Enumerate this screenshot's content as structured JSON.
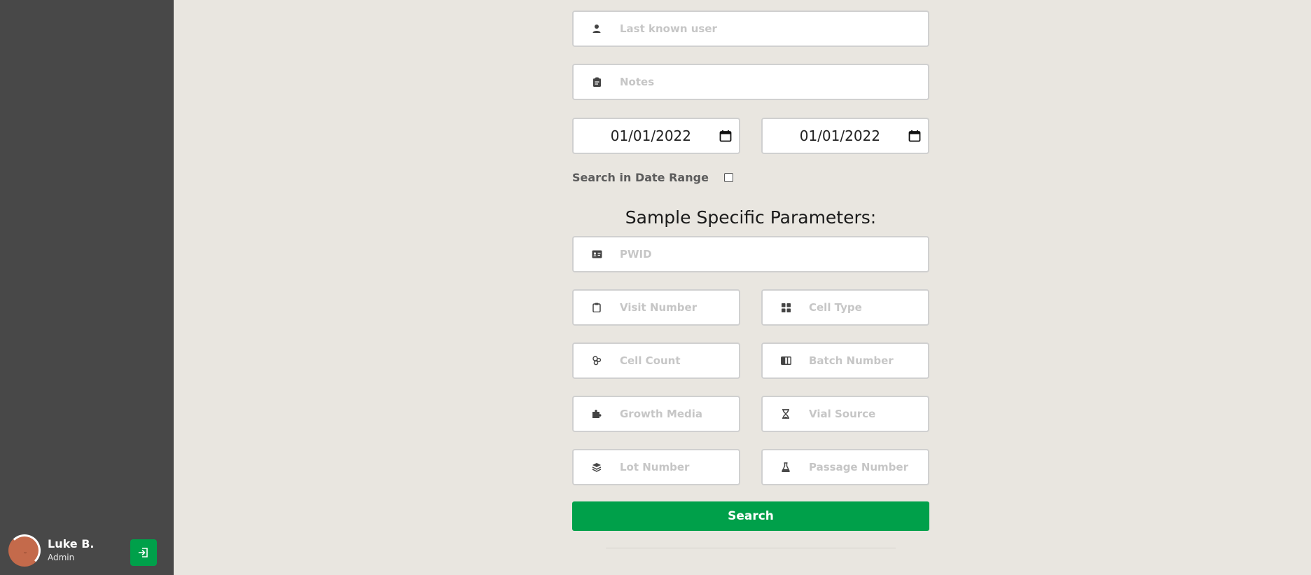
{
  "sidebar": {
    "user": {
      "name": "Luke B.",
      "role": "Admin"
    }
  },
  "form": {
    "last_known_user": {
      "placeholder": "Last known user",
      "icon": "user-icon"
    },
    "notes": {
      "placeholder": "Notes",
      "icon": "clipboard-icon"
    },
    "date_from": {
      "value": "01/01/2022"
    },
    "date_to": {
      "value": "01/01/2022"
    },
    "date_range": {
      "label": "Search in Date Range",
      "checked": false
    },
    "section_title": "Sample Specific Parameters:",
    "pwid": {
      "placeholder": "PWID",
      "icon": "id-card-icon"
    },
    "visit_number": {
      "placeholder": "Visit Number",
      "icon": "clipboard-outline-icon"
    },
    "cell_type": {
      "placeholder": "Cell Type",
      "icon": "grid-icon"
    },
    "cell_count": {
      "placeholder": "Cell Count",
      "icon": "cells-icon"
    },
    "batch_number": {
      "placeholder": "Batch Number",
      "icon": "columns-icon"
    },
    "growth_media": {
      "placeholder": "Growth Media",
      "icon": "puzzle-icon"
    },
    "vial_source": {
      "placeholder": "Vial Source",
      "icon": "hourglass-icon"
    },
    "lot_number": {
      "placeholder": "Lot Number",
      "icon": "layers-icon"
    },
    "passage_number": {
      "placeholder": "Passage Number",
      "icon": "flask-icon"
    },
    "search_label": "Search"
  },
  "colors": {
    "sidebar": "#484848",
    "background": "#e9e6e0",
    "accent": "#00a04a"
  }
}
